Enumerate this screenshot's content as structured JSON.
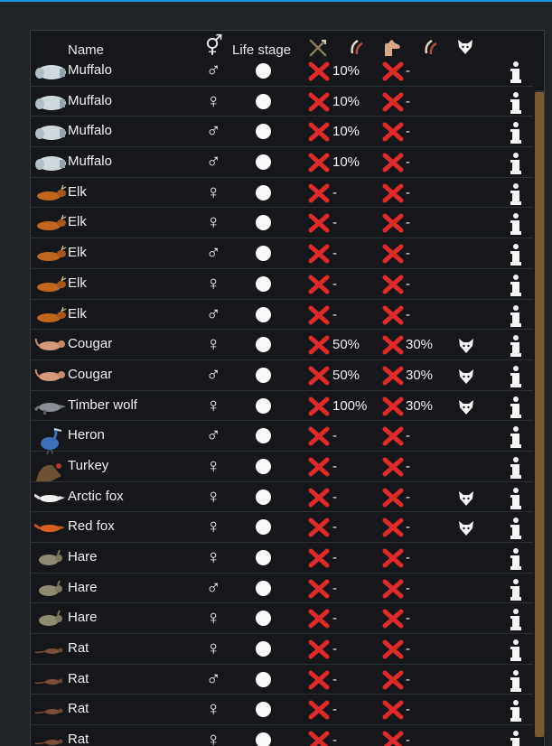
{
  "header": {
    "name_label": "Name",
    "gender_symbol": "⚥",
    "life_stage_label": "Life stage",
    "icons": [
      "bow-icon",
      "claw-icon",
      "hand-icon",
      "claw-icon",
      "wolf-icon"
    ]
  },
  "colors": {
    "accent": "#1e90d8",
    "cross": "#e02a2a",
    "scrollbar": "#7a5a2e",
    "panel": "#15171a"
  },
  "rows": [
    {
      "name": "Muffalo",
      "gender": "♂",
      "v1": "10%",
      "v2": "-",
      "wolf": false,
      "icon": "muffalo"
    },
    {
      "name": "Muffalo",
      "gender": "♀",
      "v1": "10%",
      "v2": "-",
      "wolf": false,
      "icon": "muffalo"
    },
    {
      "name": "Muffalo",
      "gender": "♂",
      "v1": "10%",
      "v2": "-",
      "wolf": false,
      "icon": "muffalo"
    },
    {
      "name": "Muffalo",
      "gender": "♂",
      "v1": "10%",
      "v2": "-",
      "wolf": false,
      "icon": "muffalo"
    },
    {
      "name": "Elk",
      "gender": "♀",
      "v1": "-",
      "v2": "-",
      "wolf": false,
      "icon": "elk"
    },
    {
      "name": "Elk",
      "gender": "♀",
      "v1": "-",
      "v2": "-",
      "wolf": false,
      "icon": "elk"
    },
    {
      "name": "Elk",
      "gender": "♂",
      "v1": "-",
      "v2": "-",
      "wolf": false,
      "icon": "elk"
    },
    {
      "name": "Elk",
      "gender": "♀",
      "v1": "-",
      "v2": "-",
      "wolf": false,
      "icon": "elk"
    },
    {
      "name": "Elk",
      "gender": "♂",
      "v1": "-",
      "v2": "-",
      "wolf": false,
      "icon": "elk"
    },
    {
      "name": "Cougar",
      "gender": "♀",
      "v1": "50%",
      "v2": "30%",
      "wolf": true,
      "icon": "cougar"
    },
    {
      "name": "Cougar",
      "gender": "♂",
      "v1": "50%",
      "v2": "30%",
      "wolf": true,
      "icon": "cougar"
    },
    {
      "name": "Timber wolf",
      "gender": "♀",
      "v1": "100%",
      "v2": "30%",
      "wolf": true,
      "icon": "wolf"
    },
    {
      "name": "Heron",
      "gender": "♂",
      "v1": "-",
      "v2": "-",
      "wolf": false,
      "icon": "heron"
    },
    {
      "name": "Turkey",
      "gender": "♀",
      "v1": "-",
      "v2": "-",
      "wolf": false,
      "icon": "turkey"
    },
    {
      "name": "Arctic fox",
      "gender": "♀",
      "v1": "-",
      "v2": "-",
      "wolf": true,
      "icon": "arcticfox"
    },
    {
      "name": "Red fox",
      "gender": "♀",
      "v1": "-",
      "v2": "-",
      "wolf": true,
      "icon": "redfox"
    },
    {
      "name": "Hare",
      "gender": "♀",
      "v1": "-",
      "v2": "-",
      "wolf": false,
      "icon": "hare"
    },
    {
      "name": "Hare",
      "gender": "♂",
      "v1": "-",
      "v2": "-",
      "wolf": false,
      "icon": "hare"
    },
    {
      "name": "Hare",
      "gender": "♀",
      "v1": "-",
      "v2": "-",
      "wolf": false,
      "icon": "hare"
    },
    {
      "name": "Rat",
      "gender": "♀",
      "v1": "-",
      "v2": "-",
      "wolf": false,
      "icon": "rat"
    },
    {
      "name": "Rat",
      "gender": "♂",
      "v1": "-",
      "v2": "-",
      "wolf": false,
      "icon": "rat"
    },
    {
      "name": "Rat",
      "gender": "♀",
      "v1": "-",
      "v2": "-",
      "wolf": false,
      "icon": "rat"
    },
    {
      "name": "Rat",
      "gender": "♀",
      "v1": "-",
      "v2": "-",
      "wolf": false,
      "icon": "rat"
    }
  ]
}
